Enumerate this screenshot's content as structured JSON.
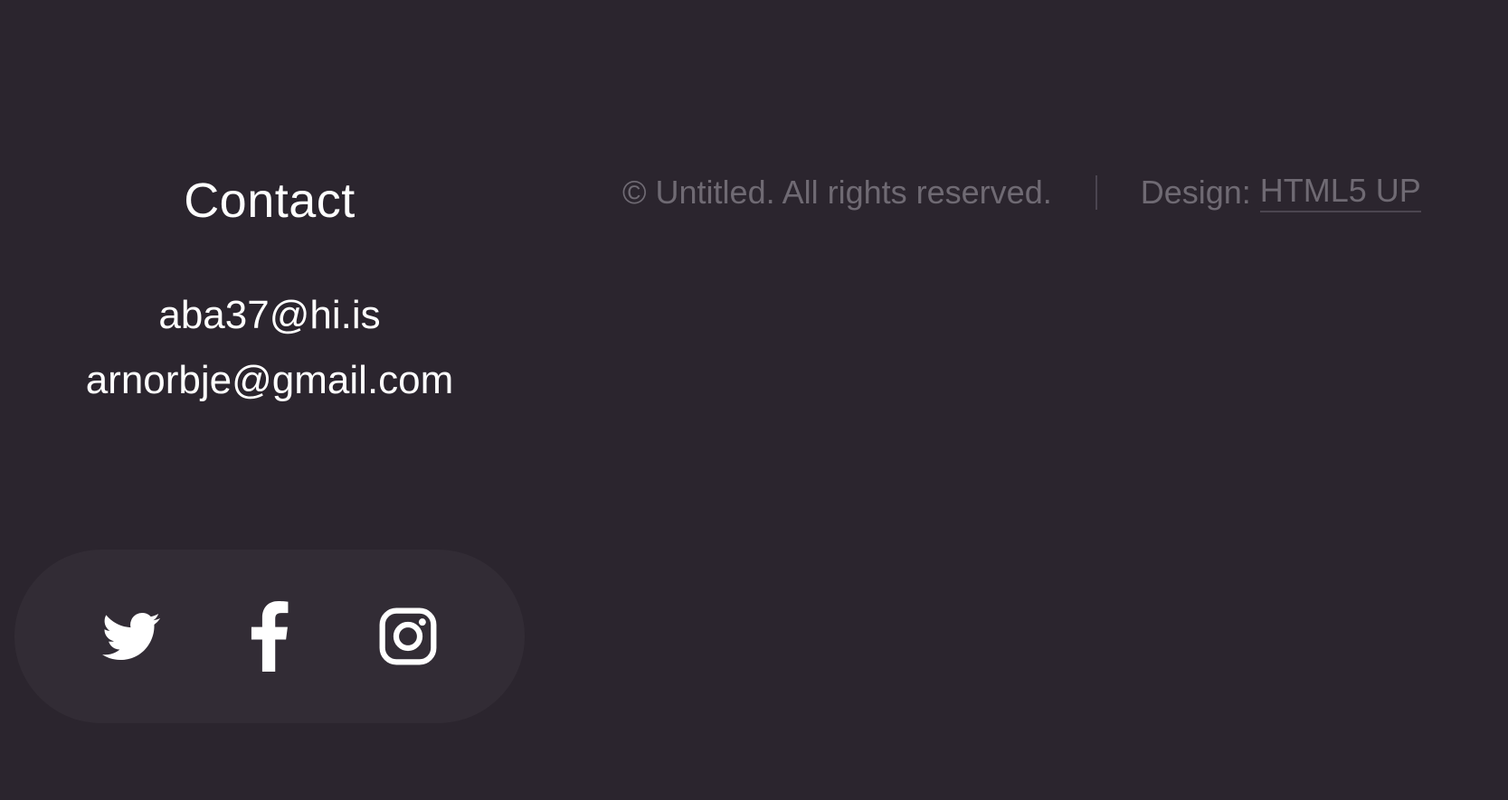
{
  "contact": {
    "title": "Contact",
    "emails": [
      "aba37@hi.is",
      "arnorbje@gmail.com"
    ]
  },
  "social": {
    "icons": [
      "twitter-icon",
      "facebook-icon",
      "instagram-icon"
    ]
  },
  "copyright": {
    "text": "© Untitled. All rights reserved.",
    "design_prefix": "Design:",
    "design_link": "HTML5 UP"
  },
  "colors": {
    "background": "#2b252e",
    "social_bar": "#322c35",
    "text_primary": "#ffffff",
    "text_muted": "#6f6a73",
    "divider": "#4b4550"
  }
}
